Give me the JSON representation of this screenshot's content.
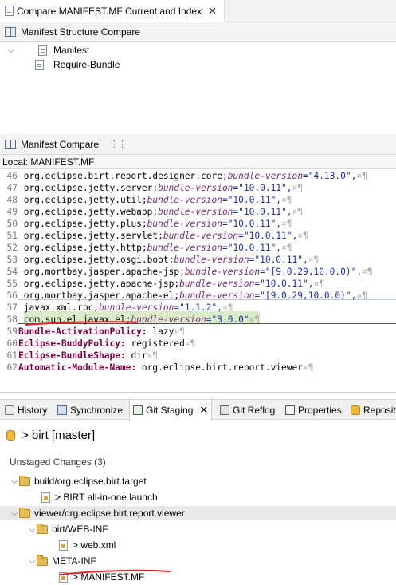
{
  "editor": {
    "tab_title": "Compare MANIFEST.MF Current and Index",
    "close_glyph": "✕"
  },
  "structure_pane": {
    "title": "Manifest Structure Compare",
    "tree": [
      {
        "label": "Manifest",
        "expanded": true
      },
      {
        "label": "Require-Bundle"
      }
    ]
  },
  "compare_pane": {
    "title": "Manifest Compare",
    "local_label": "Local: MANIFEST.MF",
    "lines": [
      {
        "n": "46",
        "parts": [
          [
            "t",
            " org.eclipse.birt.report.designer.core;"
          ],
          [
            "i",
            "bundle-version"
          ],
          [
            "t",
            "=\"4.13.0\","
          ],
          [
            "w",
            "¤¶"
          ]
        ]
      },
      {
        "n": "47",
        "parts": [
          [
            "t",
            " org.eclipse.jetty.server;"
          ],
          [
            "i",
            "bundle-version"
          ],
          [
            "t",
            "=\"10.0.11\","
          ],
          [
            "w",
            "¤¶"
          ]
        ]
      },
      {
        "n": "48",
        "parts": [
          [
            "t",
            " org.eclipse.jetty.util;"
          ],
          [
            "i",
            "bundle-version"
          ],
          [
            "t",
            "=\"10.0.11\","
          ],
          [
            "w",
            "¤¶"
          ]
        ]
      },
      {
        "n": "49",
        "parts": [
          [
            "t",
            " org.eclipse.jetty.webapp;"
          ],
          [
            "i",
            "bundle-version"
          ],
          [
            "t",
            "=\"10.0.11\","
          ],
          [
            "w",
            "¤¶"
          ]
        ]
      },
      {
        "n": "50",
        "parts": [
          [
            "t",
            " org.eclipse.jetty.plus;"
          ],
          [
            "i",
            "bundle-version"
          ],
          [
            "t",
            "=\"10.0.11\","
          ],
          [
            "w",
            "¤¶"
          ]
        ]
      },
      {
        "n": "51",
        "parts": [
          [
            "t",
            " org.eclipse.jetty.servlet;"
          ],
          [
            "i",
            "bundle-version"
          ],
          [
            "t",
            "=\"10.0.11\","
          ],
          [
            "w",
            "¤¶"
          ]
        ]
      },
      {
        "n": "52",
        "parts": [
          [
            "t",
            " org.eclipse.jetty.http;"
          ],
          [
            "i",
            "bundle-version"
          ],
          [
            "t",
            "=\"10.0.11\","
          ],
          [
            "w",
            "¤¶"
          ]
        ]
      },
      {
        "n": "53",
        "parts": [
          [
            "t",
            " org.eclipse.jetty.osgi.boot;"
          ],
          [
            "i",
            "bundle-version"
          ],
          [
            "t",
            "=\"10.0.11\","
          ],
          [
            "w",
            "¤¶"
          ]
        ]
      },
      {
        "n": "54",
        "parts": [
          [
            "t",
            " org.mortbay.jasper.apache-jsp;"
          ],
          [
            "i",
            "bundle-version"
          ],
          [
            "t",
            "=\"[9.0.29,10.0.0)\","
          ],
          [
            "w",
            "¤¶"
          ]
        ]
      },
      {
        "n": "55",
        "parts": [
          [
            "t",
            " org.eclipse.jetty.apache-jsp;"
          ],
          [
            "i",
            "bundle-version"
          ],
          [
            "t",
            "=\"10.0.11\","
          ],
          [
            "w",
            "¤¶"
          ]
        ]
      },
      {
        "n": "56",
        "parts": [
          [
            "t",
            " org.mortbay.jasper.apache-el;"
          ],
          [
            "i",
            "bundle-version"
          ],
          [
            "t",
            "=\"[9.0.29,10.0.0)\","
          ],
          [
            "w",
            "¤¶"
          ]
        ]
      },
      {
        "n": "57",
        "parts": [
          [
            "t",
            " javax.xml.rpc;"
          ],
          [
            "i",
            "bundle-version"
          ],
          [
            "t",
            "=\"1.1.2\","
          ],
          [
            "w",
            "¤¶"
          ]
        ],
        "changed": true
      },
      {
        "n": "58",
        "parts": [
          [
            "t",
            " com.sun.el.javax.el;"
          ],
          [
            "i",
            "bundle-version"
          ],
          [
            "t",
            "=\"3.0.0\""
          ],
          [
            "w",
            "¤¶"
          ]
        ],
        "changed": true
      },
      {
        "n": "59",
        "parts": [
          [
            "k",
            "Bundle-ActivationPolicy:"
          ],
          [
            "t",
            " lazy"
          ],
          [
            "w",
            "¤¶"
          ]
        ]
      },
      {
        "n": "60",
        "parts": [
          [
            "k",
            "Eclipse-BuddyPolicy:"
          ],
          [
            "t",
            " registered"
          ],
          [
            "w",
            "¤¶"
          ]
        ]
      },
      {
        "n": "61",
        "parts": [
          [
            "k",
            "Eclipse-BundleShape:"
          ],
          [
            "t",
            " dir"
          ],
          [
            "w",
            "¤¶"
          ]
        ]
      },
      {
        "n": "62",
        "parts": [
          [
            "k",
            "Automatic-Module-Name:"
          ],
          [
            "t",
            " org.eclipse.birt.report.viewer"
          ],
          [
            "w",
            "¤¶"
          ]
        ]
      }
    ],
    "annotation_color": "#e0262b"
  },
  "view_tabs": [
    {
      "label": "History",
      "active": false
    },
    {
      "label": "Synchronize",
      "active": false
    },
    {
      "label": "Git Staging",
      "active": true
    },
    {
      "label": "Git Reflog",
      "active": false
    },
    {
      "label": "Properties",
      "active": false
    },
    {
      "label": "Reposit",
      "active": false
    }
  ],
  "staging": {
    "repo_label": "> birt [master]",
    "unstaged_title": "Unstaged Changes (3)",
    "tree": [
      {
        "label": "build/org.eclipse.birt.target",
        "kind": "folder",
        "level": 0,
        "expanded": true
      },
      {
        "label": "> BIRT all-in-one.launch",
        "kind": "file",
        "level": 1
      },
      {
        "label": "viewer/org.eclipse.birt.report.viewer",
        "kind": "folder",
        "level": 0,
        "expanded": true,
        "selected": true
      },
      {
        "label": "birt/WEB-INF",
        "kind": "folder",
        "level": 1,
        "expanded": true
      },
      {
        "label": "> web.xml",
        "kind": "file",
        "level": 2
      },
      {
        "label": "META-INF",
        "kind": "folder",
        "level": 1,
        "expanded": true
      },
      {
        "label": "> MANIFEST.MF",
        "kind": "file",
        "level": 2
      }
    ]
  }
}
